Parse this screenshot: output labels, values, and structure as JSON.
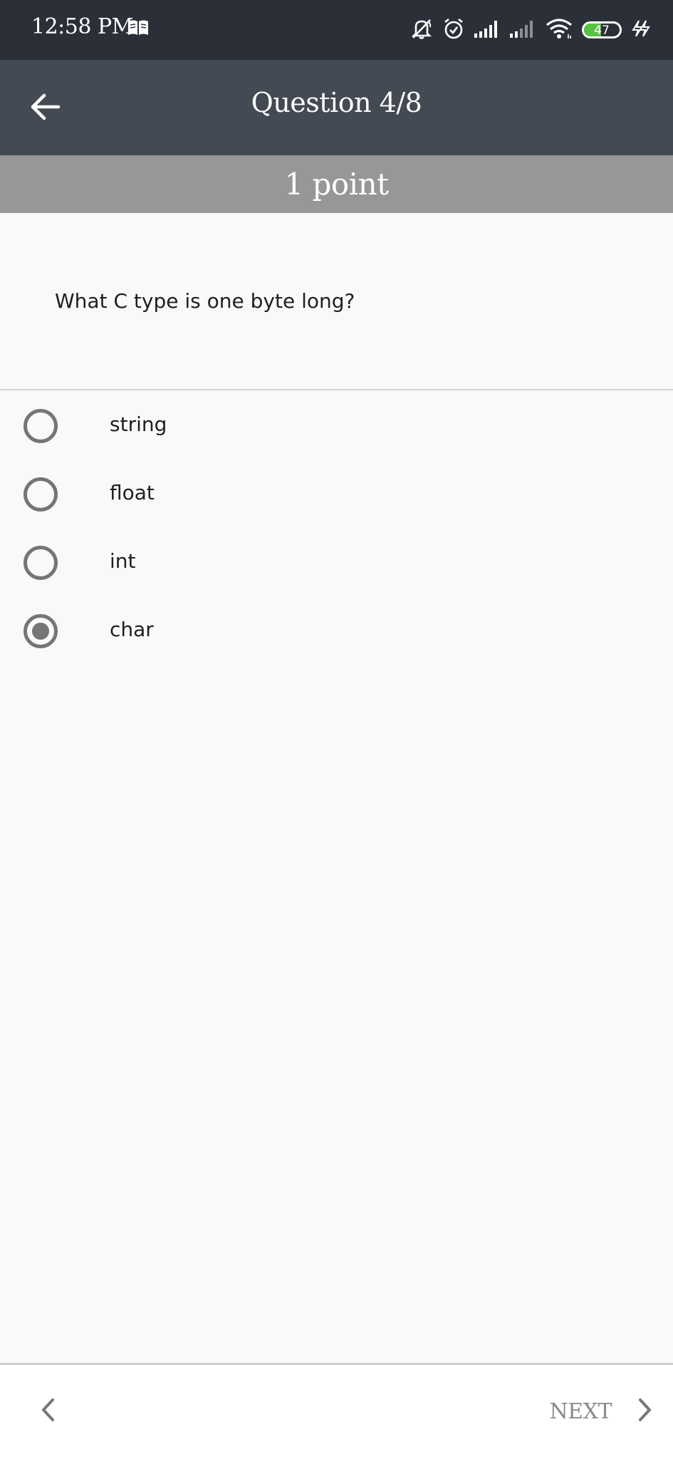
{
  "status_bar": {
    "time": "12:58 PM",
    "battery_level": "47",
    "battery_fraction": 0.47,
    "icons": [
      "book-icon",
      "mute-icon",
      "alarm-icon",
      "signal-icon",
      "signal-weak-icon",
      "wifi-icon",
      "battery-icon",
      "charging-icon"
    ]
  },
  "app_bar": {
    "title": "Question 4/8",
    "back_icon": "arrow-left-icon"
  },
  "points": {
    "label": "1 point"
  },
  "question": {
    "text": "What C type is one byte long?"
  },
  "options": [
    {
      "label": "string",
      "selected": false
    },
    {
      "label": "float",
      "selected": false
    },
    {
      "label": "int",
      "selected": false
    },
    {
      "label": "char",
      "selected": true
    }
  ],
  "bottom_nav": {
    "prev_icon": "chevron-left-icon",
    "next_label": "NEXT",
    "next_icon": "chevron-right-icon"
  },
  "colors": {
    "status_bar_bg": "#2b3038",
    "app_bar_bg": "#434a54",
    "points_bar_bg": "#979797",
    "page_bg": "#f9f9f9",
    "radio": "#757575",
    "battery_fill": "#59c244"
  }
}
